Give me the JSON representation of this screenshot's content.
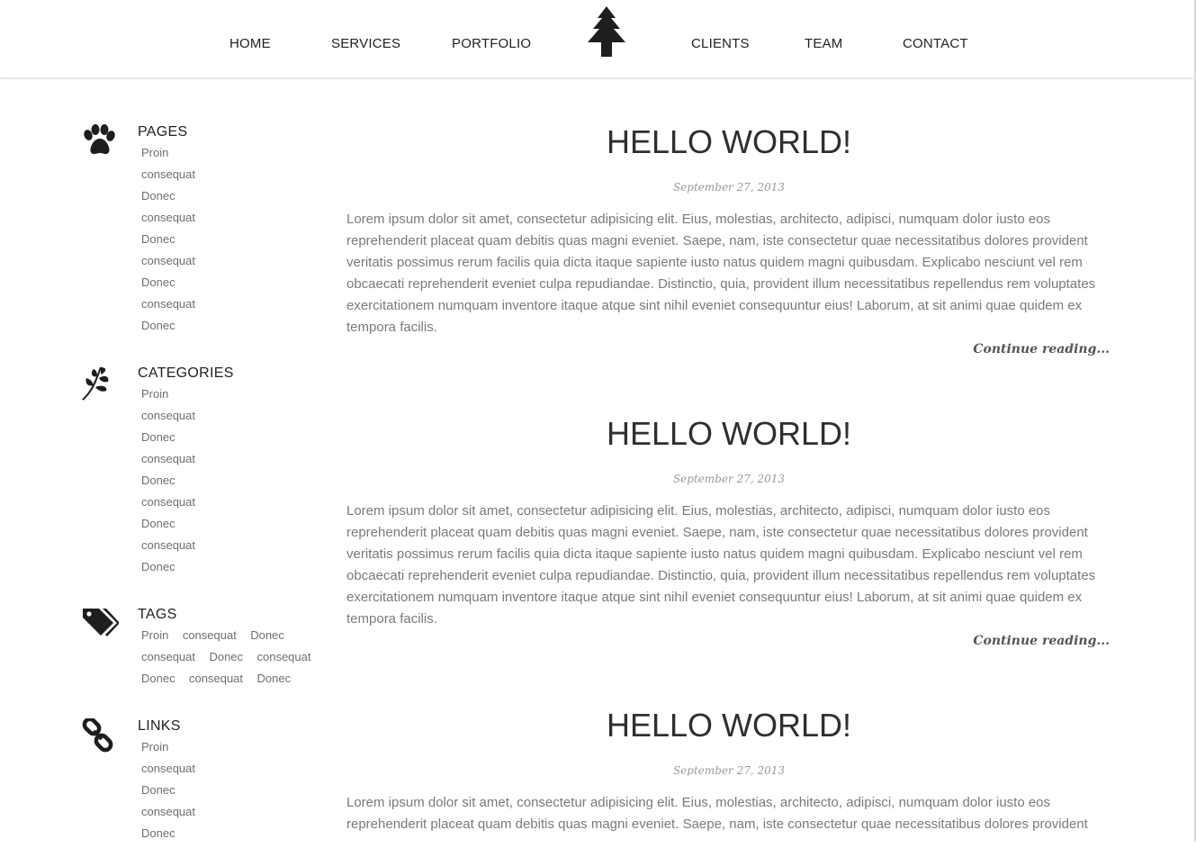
{
  "nav": {
    "left": [
      "HOME",
      "SERVICES",
      "PORTFOLIO"
    ],
    "right": [
      "CLIENTS",
      "TEAM",
      "CONTACT"
    ],
    "logo_icon": "pine-tree-icon"
  },
  "sidebar": {
    "pages": {
      "title": "PAGES",
      "icon": "paw-icon",
      "items": [
        "Proin",
        "consequat",
        "Donec",
        "consequat",
        "Donec",
        "consequat",
        "Donec",
        "consequat",
        "Donec"
      ]
    },
    "categories": {
      "title": "CATEGORIES",
      "icon": "leaf-branch-icon",
      "items": [
        "Proin",
        "consequat",
        "Donec",
        "consequat",
        "Donec",
        "consequat",
        "Donec",
        "consequat",
        "Donec"
      ]
    },
    "tags": {
      "title": "TAGS",
      "icon": "tags-icon",
      "rows": [
        [
          "Proin",
          "consequat",
          "Donec"
        ],
        [
          "consequat",
          "Donec",
          "consequat"
        ],
        [
          "Donec",
          "consequat",
          "Donec"
        ]
      ]
    },
    "links": {
      "title": "LINKS",
      "icon": "chain-link-icon",
      "items": [
        "Proin",
        "consequat",
        "Donec",
        "consequat",
        "Donec"
      ]
    }
  },
  "posts": [
    {
      "title": "HELLO WORLD!",
      "date": "September 27, 2013",
      "body": "Lorem ipsum dolor sit amet, consectetur adipisicing elit. Eius, molestias, architecto, adipisci, numquam dolor iusto eos reprehenderit placeat quam debitis quas magni eveniet. Saepe, nam, iste consectetur quae necessitatibus dolores provident veritatis possimus rerum facilis quia dicta itaque sapiente iusto natus quidem magni quibusdam. Explicabo nesciunt vel rem obcaecati reprehenderit eveniet culpa repudiandae. Distinctio, quia, provident illum necessitatibus repellendus rem voluptates exercitationem numquam inventore itaque atque sint nihil eveniet consequuntur eius! Laborum, at sit animi quae quidem ex tempora facilis.",
      "more": "Continue reading..."
    },
    {
      "title": "HELLO WORLD!",
      "date": "September 27, 2013",
      "body": "Lorem ipsum dolor sit amet, consectetur adipisicing elit. Eius, molestias, architecto, adipisci, numquam dolor iusto eos reprehenderit placeat quam debitis quas magni eveniet. Saepe, nam, iste consectetur quae necessitatibus dolores provident veritatis possimus rerum facilis quia dicta itaque sapiente iusto natus quidem magni quibusdam. Explicabo nesciunt vel rem obcaecati reprehenderit eveniet culpa repudiandae. Distinctio, quia, provident illum necessitatibus repellendus rem voluptates exercitationem numquam inventore itaque atque sint nihil eveniet consequuntur eius! Laborum, at sit animi quae quidem ex tempora facilis.",
      "more": "Continue reading..."
    },
    {
      "title": "HELLO WORLD!",
      "date": "September 27, 2013",
      "body": "Lorem ipsum dolor sit amet, consectetur adipisicing elit. Eius, molestias, architecto, adipisci, numquam dolor iusto eos reprehenderit placeat quam debitis quas magni eveniet. Saepe, nam, iste consectetur quae necessitatibus dolores provident",
      "more": ""
    }
  ],
  "colors": {
    "text": "#333333",
    "muted": "#7a7a7a",
    "link": "#6f6f6f",
    "border": "#e2e2e2"
  }
}
